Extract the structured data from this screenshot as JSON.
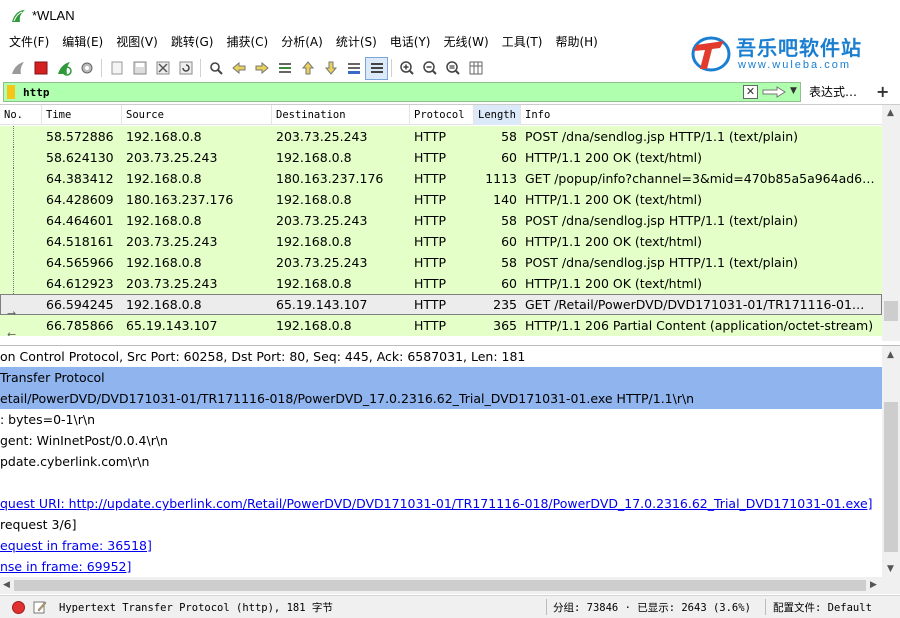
{
  "window": {
    "title": "*WLAN"
  },
  "menu": [
    "文件(F)",
    "编辑(E)",
    "视图(V)",
    "跳转(G)",
    "捕获(C)",
    "分析(A)",
    "统计(S)",
    "电话(Y)",
    "无线(W)",
    "工具(T)",
    "帮助(H)"
  ],
  "logo": {
    "name": "吾乐吧软件站",
    "url": "www.wuleba.com"
  },
  "filter": {
    "value": "http",
    "expression_label": "表达式…",
    "plus": "+"
  },
  "columns": [
    "No.",
    "Time",
    "Source",
    "Destination",
    "Protocol",
    "Length",
    "Info"
  ],
  "packets": [
    {
      "time": "58.572886",
      "source": "192.168.0.8",
      "destination": "203.73.25.243",
      "protocol": "HTTP",
      "length": "58",
      "info": "POST /dna/sendlog.jsp HTTP/1.1  (text/plain)"
    },
    {
      "time": "58.624130",
      "source": "203.73.25.243",
      "destination": "192.168.0.8",
      "protocol": "HTTP",
      "length": "60",
      "info": "HTTP/1.1 200 OK  (text/html)"
    },
    {
      "time": "64.383412",
      "source": "192.168.0.8",
      "destination": "180.163.237.176",
      "protocol": "HTTP",
      "length": "1113",
      "info": "GET /popup/info?channel=3&mid=470b85a5a964ad6…"
    },
    {
      "time": "64.428609",
      "source": "180.163.237.176",
      "destination": "192.168.0.8",
      "protocol": "HTTP",
      "length": "140",
      "info": "HTTP/1.1 200 OK  (text/html)"
    },
    {
      "time": "64.464601",
      "source": "192.168.0.8",
      "destination": "203.73.25.243",
      "protocol": "HTTP",
      "length": "58",
      "info": "POST /dna/sendlog.jsp HTTP/1.1  (text/plain)"
    },
    {
      "time": "64.518161",
      "source": "203.73.25.243",
      "destination": "192.168.0.8",
      "protocol": "HTTP",
      "length": "60",
      "info": "HTTP/1.1 200 OK  (text/html)"
    },
    {
      "time": "64.565966",
      "source": "192.168.0.8",
      "destination": "203.73.25.243",
      "protocol": "HTTP",
      "length": "58",
      "info": "POST /dna/sendlog.jsp HTTP/1.1  (text/plain)"
    },
    {
      "time": "64.612923",
      "source": "203.73.25.243",
      "destination": "192.168.0.8",
      "protocol": "HTTP",
      "length": "60",
      "info": "HTTP/1.1 200 OK  (text/html)"
    },
    {
      "time": "66.594245",
      "source": "192.168.0.8",
      "destination": "65.19.143.107",
      "protocol": "HTTP",
      "length": "235",
      "info": "GET /Retail/PowerDVD/DVD171031-01/TR171116-01…",
      "selected": true
    },
    {
      "time": "66.785866",
      "source": "65.19.143.107",
      "destination": "192.168.0.8",
      "protocol": "HTTP",
      "length": "365",
      "info": "HTTP/1.1 206 Partial Content  (application/octet-stream)"
    }
  ],
  "details": [
    {
      "text": "on Control Protocol, Src Port: 60258, Dst Port: 80, Seq: 445, Ack: 6587031, Len: 181",
      "style": "normal"
    },
    {
      "text": " Transfer Protocol",
      "style": "hl"
    },
    {
      "text": "etail/PowerDVD/DVD171031-01/TR171116-018/PowerDVD_17.0.2316.62_Trial_DVD171031-01.exe HTTP/1.1\\r\\n",
      "style": "hl2"
    },
    {
      "text": ": bytes=0-1\\r\\n",
      "style": "normal"
    },
    {
      "text": "gent: WinInetPost/0.0.4\\r\\n",
      "style": "normal"
    },
    {
      "text": "pdate.cyberlink.com\\r\\n",
      "style": "normal"
    },
    {
      "text": "",
      "style": "normal"
    },
    {
      "text": "quest URI: http://update.cyberlink.com/Retail/PowerDVD/DVD171031-01/TR171116-018/PowerDVD_17.0.2316.62_Trial_DVD171031-01.exe]",
      "style": "link"
    },
    {
      "text": "request 3/6]",
      "style": "normal"
    },
    {
      "text": "equest in frame: 36518]",
      "style": "link"
    },
    {
      "text": "nse in frame: 69952]",
      "style": "link"
    }
  ],
  "status": {
    "text": "Hypertext Transfer Protocol (http), 181 字节",
    "stats": "分组: 73846 · 已显示: 2643 (3.6%)",
    "profile": "配置文件: Default"
  },
  "colors": {
    "row_green": "#e4ffc7",
    "filter_green": "#afffaf",
    "selection_blue": "#8fb4ee",
    "logo_blue": "#1a7fd1"
  }
}
